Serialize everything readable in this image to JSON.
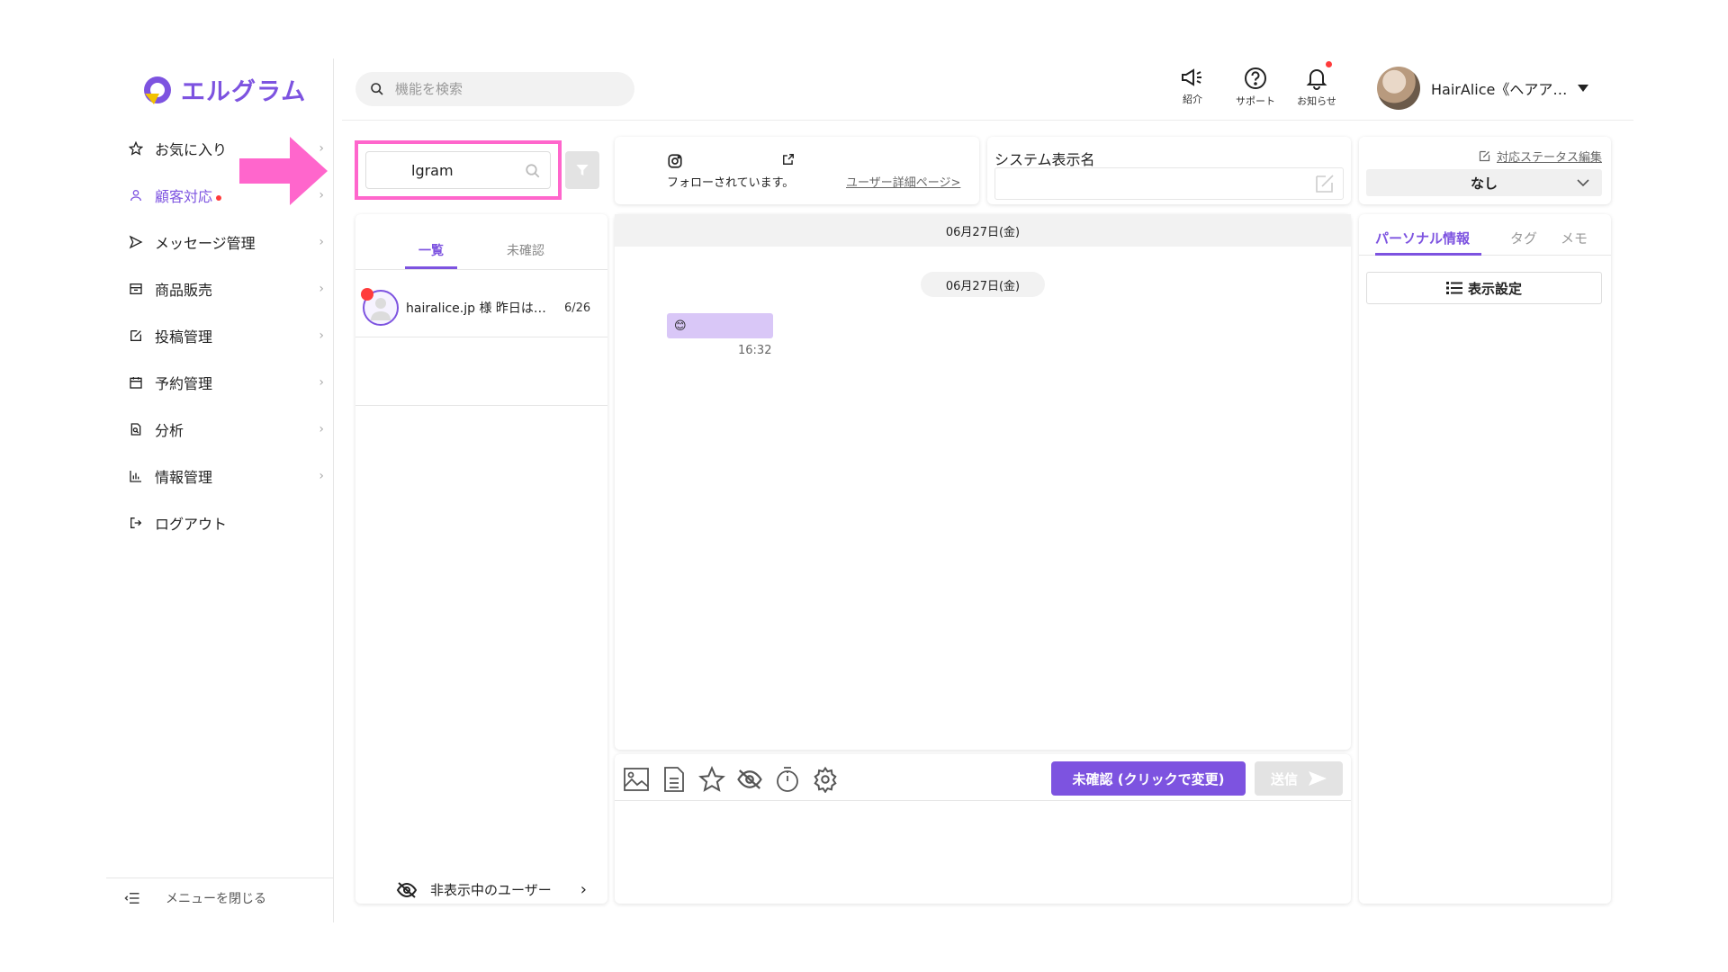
{
  "app": {
    "logo_text": "エルグラム",
    "brand_color": "#7d53e0",
    "highlight_color": "#ff66cc"
  },
  "sidebar": {
    "items": [
      {
        "label": "お気に入り",
        "icon": "star-icon"
      },
      {
        "label": "顧客対応",
        "icon": "user-icon",
        "active": true
      },
      {
        "label": "メッセージ管理",
        "icon": "send-icon"
      },
      {
        "label": "商品販売",
        "icon": "store-icon"
      },
      {
        "label": "投稿管理",
        "icon": "edit-icon"
      },
      {
        "label": "予約管理",
        "icon": "calendar-icon"
      },
      {
        "label": "分析",
        "icon": "analysis-icon"
      },
      {
        "label": "情報管理",
        "icon": "chart-icon"
      },
      {
        "label": "ログアウト",
        "icon": "logout-icon"
      }
    ],
    "close_label": "メニューを閉じる"
  },
  "header": {
    "search_placeholder": "機能を検索",
    "buttons": [
      {
        "label": "紹介",
        "icon": "megaphone-icon"
      },
      {
        "label": "サポート",
        "icon": "help-icon"
      },
      {
        "label": "お知らせ",
        "icon": "bell-icon"
      }
    ],
    "user_name": "HairAlice《ヘアア…"
  },
  "list": {
    "search_value": "lgram",
    "tabs": [
      "一覧",
      "未確認"
    ],
    "conversations": [
      {
        "name": "hairalice.jp 様 昨日は…",
        "date": "6/26",
        "unread": true
      }
    ],
    "hidden_users_label": "非表示中のユーザー"
  },
  "user_card": {
    "follow_text": "フォローされています。",
    "detail_link": "ユーザー詳細ページ>"
  },
  "system_name": {
    "label": "システム表示名",
    "value": ""
  },
  "status": {
    "edit_label": "対応ステータス編集",
    "value": "なし"
  },
  "chat": {
    "date_header": "06月27日(金)",
    "date_pill": "06月27日(金)",
    "messages": [
      {
        "text": "😊",
        "time": "16:32"
      }
    ]
  },
  "composer": {
    "unread_button": "未確認 (クリックで変更)",
    "send_button": "送信"
  },
  "info_panel": {
    "tabs": [
      "パーソナル情報",
      "タグ",
      "メモ"
    ],
    "display_settings_label": "表示設定"
  }
}
